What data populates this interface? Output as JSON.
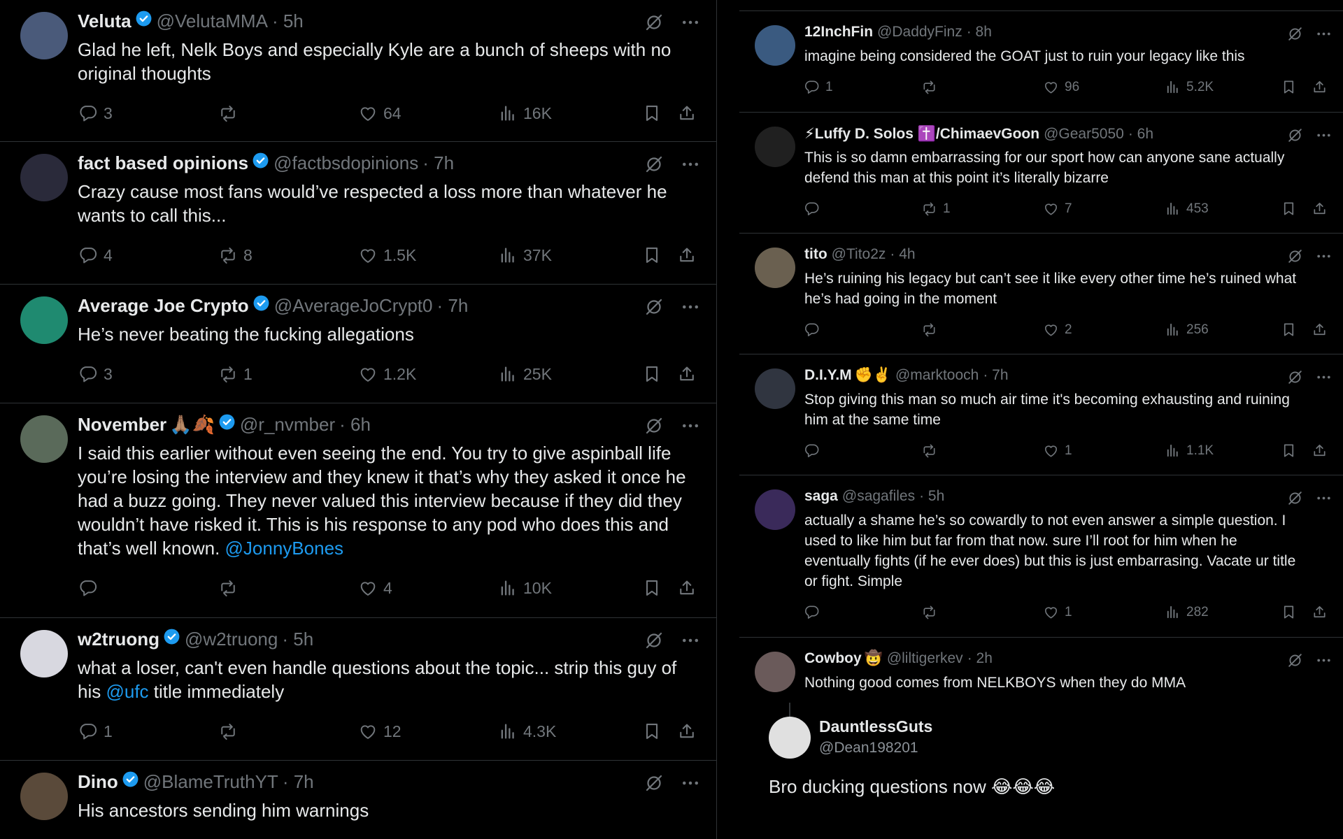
{
  "left_tweets": [
    {
      "name": "Veluta",
      "verified": true,
      "emoji": "",
      "handle": "@VelutaMMA",
      "time": "· 5h",
      "text_lines": [
        "Glad he left, Nelk Boys and especially Kyle are a bunch of sheeps with no",
        "original thoughts"
      ],
      "replies": "3",
      "reposts": "",
      "likes": "64",
      "views": "16K",
      "avatar_color": "#4a5a7a"
    },
    {
      "name": "fact based opinions",
      "verified": true,
      "emoji": "",
      "handle": "@factbsdopinions",
      "time": "· 7h",
      "text_lines": [
        "Crazy cause most fans would’ve respected a loss more than whatever he",
        "wants to call this..."
      ],
      "replies": "4",
      "reposts": "8",
      "likes": "1.5K",
      "views": "37K",
      "avatar_color": "#2a2a3a"
    },
    {
      "name": "Average Joe Crypto",
      "verified": true,
      "emoji": "",
      "handle": "@AverageJoCrypt0",
      "time": "· 7h",
      "text_lines": [
        "He’s never beating the fucking allegations"
      ],
      "replies": "3",
      "reposts": "1",
      "likes": "1.2K",
      "views": "25K",
      "avatar_color": "#1f8a70"
    },
    {
      "name": "November",
      "verified": true,
      "emoji": "🙏🏽🍂",
      "handle": "@r_nvmber",
      "time": "· 6h",
      "text_lines": [
        "I said this earlier without even seeing the end. You try to give aspinball life",
        "you’re losing the interview and they knew it that’s why they asked it once he",
        "had a buzz going. They never valued this interview because if they did they",
        "wouldn’t have risked it. This is his response to any pod who does this and",
        "that’s well known."
      ],
      "mention": "@JonnyBones",
      "replies": "",
      "reposts": "",
      "likes": "4",
      "views": "10K",
      "avatar_color": "#5a6a5a"
    },
    {
      "name": "w2truong",
      "verified": true,
      "emoji": "",
      "handle": "@w2truong",
      "time": "· 5h",
      "text_lines": [
        "what a loser, can't even handle questions about the topic... strip this guy of"
      ],
      "line2_prefix": "his",
      "line2_mention": "@ufc",
      "line2_suffix": "title immediately",
      "replies": "1",
      "reposts": "",
      "likes": "12",
      "views": "4.3K",
      "avatar_color": "#d8d8e0"
    },
    {
      "name": "Dino",
      "verified": true,
      "emoji": "",
      "handle": "@BlameTruthYT",
      "time": "· 7h",
      "text_lines": [
        "His ancestors sending him warnings"
      ],
      "replies": "",
      "reposts": "",
      "likes": "",
      "views": "",
      "avatar_color": "#5a4a3a"
    }
  ],
  "right_tweets": [
    {
      "name": "12InchFin",
      "emoji": "",
      "handle": "@DaddyFinz",
      "time": "· 8h",
      "text_lines": [
        "imagine being considered the GOAT just to ruin your legacy like this"
      ],
      "replies": "1",
      "reposts": "",
      "likes": "96",
      "views": "5.2K",
      "avatar_color": "#3a5a80"
    },
    {
      "name": "⚡Luffy D. Solos ✝️/ChimaevGoon",
      "emoji": "",
      "handle": "@Gear5050",
      "time": "· 6h",
      "text_lines": [
        "This is so damn embarrassing for our sport how can anyone sane actually",
        "defend this man at this point it’s literally bizarre"
      ],
      "replies": "",
      "reposts": "1",
      "likes": "7",
      "views": "453",
      "avatar_color": "#202020"
    },
    {
      "name": "tito",
      "emoji": "",
      "handle": "@Tito2z",
      "time": "· 4h",
      "text_lines": [
        "He’s ruining his legacy but can’t see it like every other time he’s ruined what",
        "he’s had going in the moment"
      ],
      "replies": "",
      "reposts": "",
      "likes": "2",
      "views": "256",
      "avatar_color": "#6a6050"
    },
    {
      "name": "D.I.Y.M",
      "emoji": "✊✌️",
      "handle": "@marktooch",
      "time": "· 7h",
      "text_lines": [
        "Stop giving this man so much air time it's becoming exhausting and ruining",
        "him at the same time"
      ],
      "replies": "",
      "reposts": "",
      "likes": "1",
      "views": "1.1K",
      "avatar_color": "#303540"
    },
    {
      "name": "saga",
      "emoji": "",
      "handle": "@sagafiles",
      "time": "· 5h",
      "text_lines": [
        "actually a shame he’s so cowardly to not even answer a simple question. I",
        "used to like him but far from that now. sure I’ll root for him when he",
        "eventually fights (if he ever does) but this is just embarrasing. Vacate ur title",
        "or fight. Simple"
      ],
      "replies": "",
      "reposts": "",
      "likes": "1",
      "views": "282",
      "avatar_color": "#3a2a5a"
    },
    {
      "name": "Cowboy",
      "emoji": "🤠",
      "handle": "@liltigerkev",
      "time": "· 2h",
      "text_lines": [
        "Nothing good comes from NELKBOYS when they do MMA"
      ],
      "replies": "",
      "reposts": "",
      "likes": "",
      "views": "",
      "avatar_color": "#6a5a5a"
    }
  ],
  "quote": {
    "name": "DauntlessGuts",
    "handle": "@Dean198201",
    "text": "Bro ducking questions now",
    "emoji": "😂😂😂",
    "avatar_color": "#e0e0e0"
  }
}
